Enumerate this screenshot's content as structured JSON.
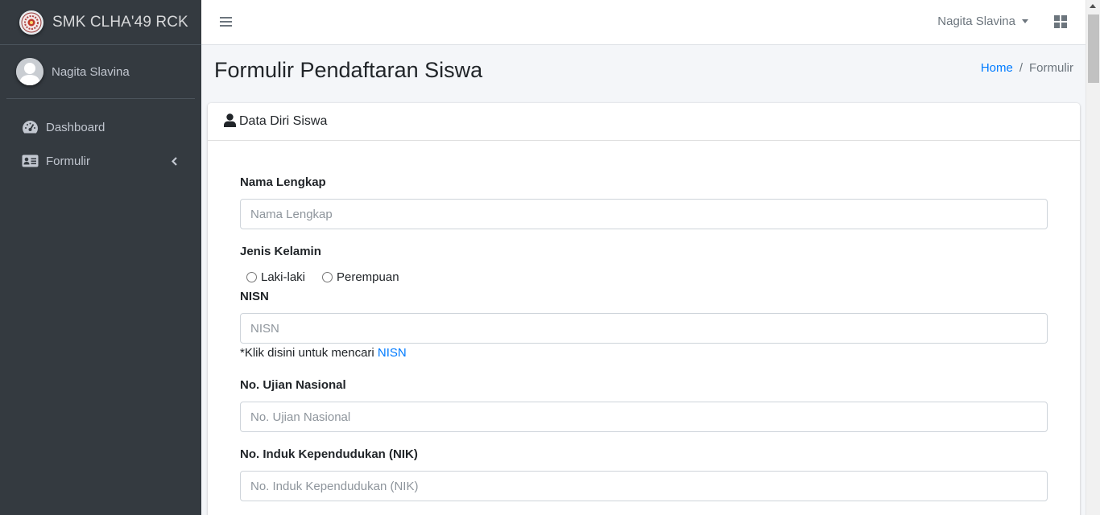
{
  "brand": {
    "name": "SMK CLHA'49 RCK"
  },
  "sidebar": {
    "user_name": "Nagita Slavina",
    "items": [
      {
        "label": "Dashboard",
        "icon": "tachometer-icon"
      },
      {
        "label": "Formulir",
        "icon": "id-card-icon"
      }
    ]
  },
  "header": {
    "user_name": "Nagita Slavina"
  },
  "content": {
    "title": "Formulir Pendaftaran Siswa",
    "breadcrumb": {
      "home": "Home",
      "separator": "/",
      "current": "Formulir"
    }
  },
  "card": {
    "title": "Data Diri Siswa",
    "fields": {
      "nama": {
        "label": "Nama Lengkap",
        "placeholder": "Nama Lengkap"
      },
      "jenis_kelamin": {
        "label": "Jenis Kelamin",
        "options": [
          "Laki-laki",
          "Perempuan"
        ]
      },
      "nisn": {
        "label": "NISN",
        "placeholder": "NISN",
        "help_text": "*Klik disini untuk mencari ",
        "help_link": "NISN"
      },
      "ujian": {
        "label": "No. Ujian Nasional",
        "placeholder": "No. Ujian Nasional"
      },
      "nik": {
        "label": "No. Induk Kependudukan (NIK)",
        "placeholder": "No. Induk Kependudukan (NIK)"
      }
    }
  },
  "colors": {
    "sidebar_bg": "#343a40",
    "link": "#007bff",
    "content_bg": "#f4f6f9"
  }
}
